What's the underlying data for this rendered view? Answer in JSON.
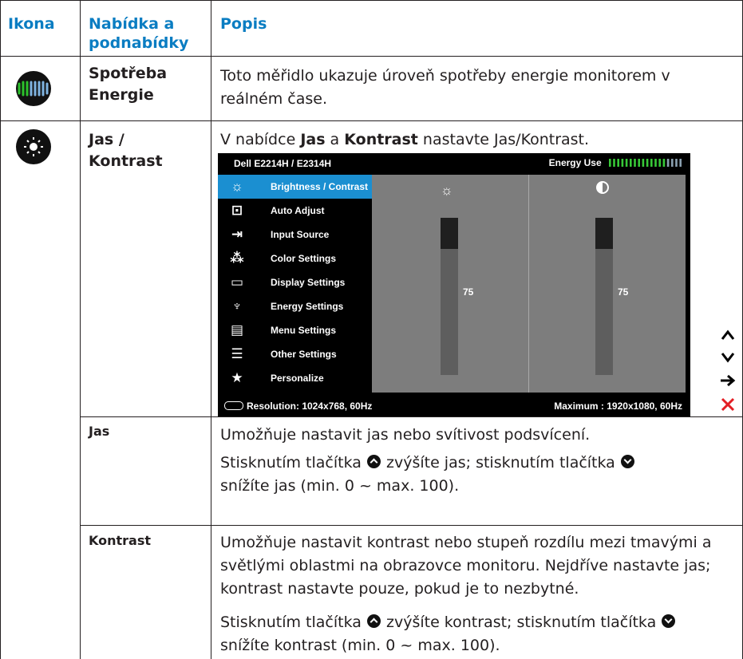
{
  "header": {
    "col_icon": "Ikona",
    "col_menu": "Nabídka a\npodnabídky",
    "col_desc": "Popis"
  },
  "rows": {
    "energy": {
      "name": "Spotřeba\nEnergie",
      "desc": "Toto měřidlo ukazuje úroveň spotřeby energie monitorem v reálném čase.",
      "icon": "energy-meter-icon"
    },
    "brightness": {
      "name": "Jas /\nKontrast",
      "desc_pre": "V nabídce ",
      "desc_b1": "Jas",
      "desc_mid": " a ",
      "desc_b2": "Kontrast",
      "desc_post": " nastavte Jas/Kontrast.",
      "icon": "brightness-icon"
    },
    "jas": {
      "name": "Jas",
      "desc1": "Umožňuje nastavit jas nebo svítivost podsvícení.",
      "desc2_a": "Stisknutím tlačítka ",
      "desc2_b": " zvýšíte jas; stisknutím tlačítka ",
      "desc2_c": "snížíte jas (min. 0 ~ max. 100)."
    },
    "kontrast": {
      "name": "Kontrast",
      "desc1": "Umožňuje nastavit kontrast nebo stupeň rozdílu mezi tmavými a světlými oblastmi na obrazovce monitoru. Nejdříve nastavte jas; kontrast nastavte pouze, pokud je to nezbytné.",
      "desc2_a": "Stisknutím tlačítka ",
      "desc2_b": " zvýšíte kontrast; stisknutím tlačítka ",
      "desc2_c": "snížíte kontrast (min. 0 ~ max. 100)."
    }
  },
  "osd": {
    "title": "Dell E2214H / E2314H",
    "energy_label": "Energy Use",
    "energy_level": 0.8,
    "menu": [
      {
        "label": "Brightness / Contrast",
        "icon": "brightness-icon",
        "glyph": "☼",
        "active": true
      },
      {
        "label": "Auto Adjust",
        "icon": "auto-adjust-icon",
        "glyph": "⊡"
      },
      {
        "label": "Input Source",
        "icon": "input-source-icon",
        "glyph": "⇥"
      },
      {
        "label": "Color Settings",
        "icon": "color-settings-icon",
        "glyph": "⁂"
      },
      {
        "label": "Display Settings",
        "icon": "display-settings-icon",
        "glyph": "▭"
      },
      {
        "label": "Energy Settings",
        "icon": "energy-settings-icon",
        "glyph": "♆"
      },
      {
        "label": "Menu Settings",
        "icon": "menu-settings-icon",
        "glyph": "▤"
      },
      {
        "label": "Other Settings",
        "icon": "other-settings-icon",
        "glyph": "☰"
      },
      {
        "label": "Personalize",
        "icon": "star-icon",
        "glyph": "★"
      }
    ],
    "brightness_value": "75",
    "contrast_value": "75",
    "brightness_level": 0.75,
    "contrast_level": 0.75,
    "resolution": "Resolution: 1024x768,  60Hz",
    "maximum": "Maximum : 1920x1080,  60Hz",
    "accent": "#1b8fd1"
  },
  "side_buttons": {
    "up": "up-arrow-icon",
    "down": "down-arrow-icon",
    "enter": "right-arrow-icon",
    "exit": "close-icon"
  },
  "colors": {
    "header_text": "#0a7dc2",
    "rule": "#231f20",
    "exit_red": "#e31e24"
  }
}
